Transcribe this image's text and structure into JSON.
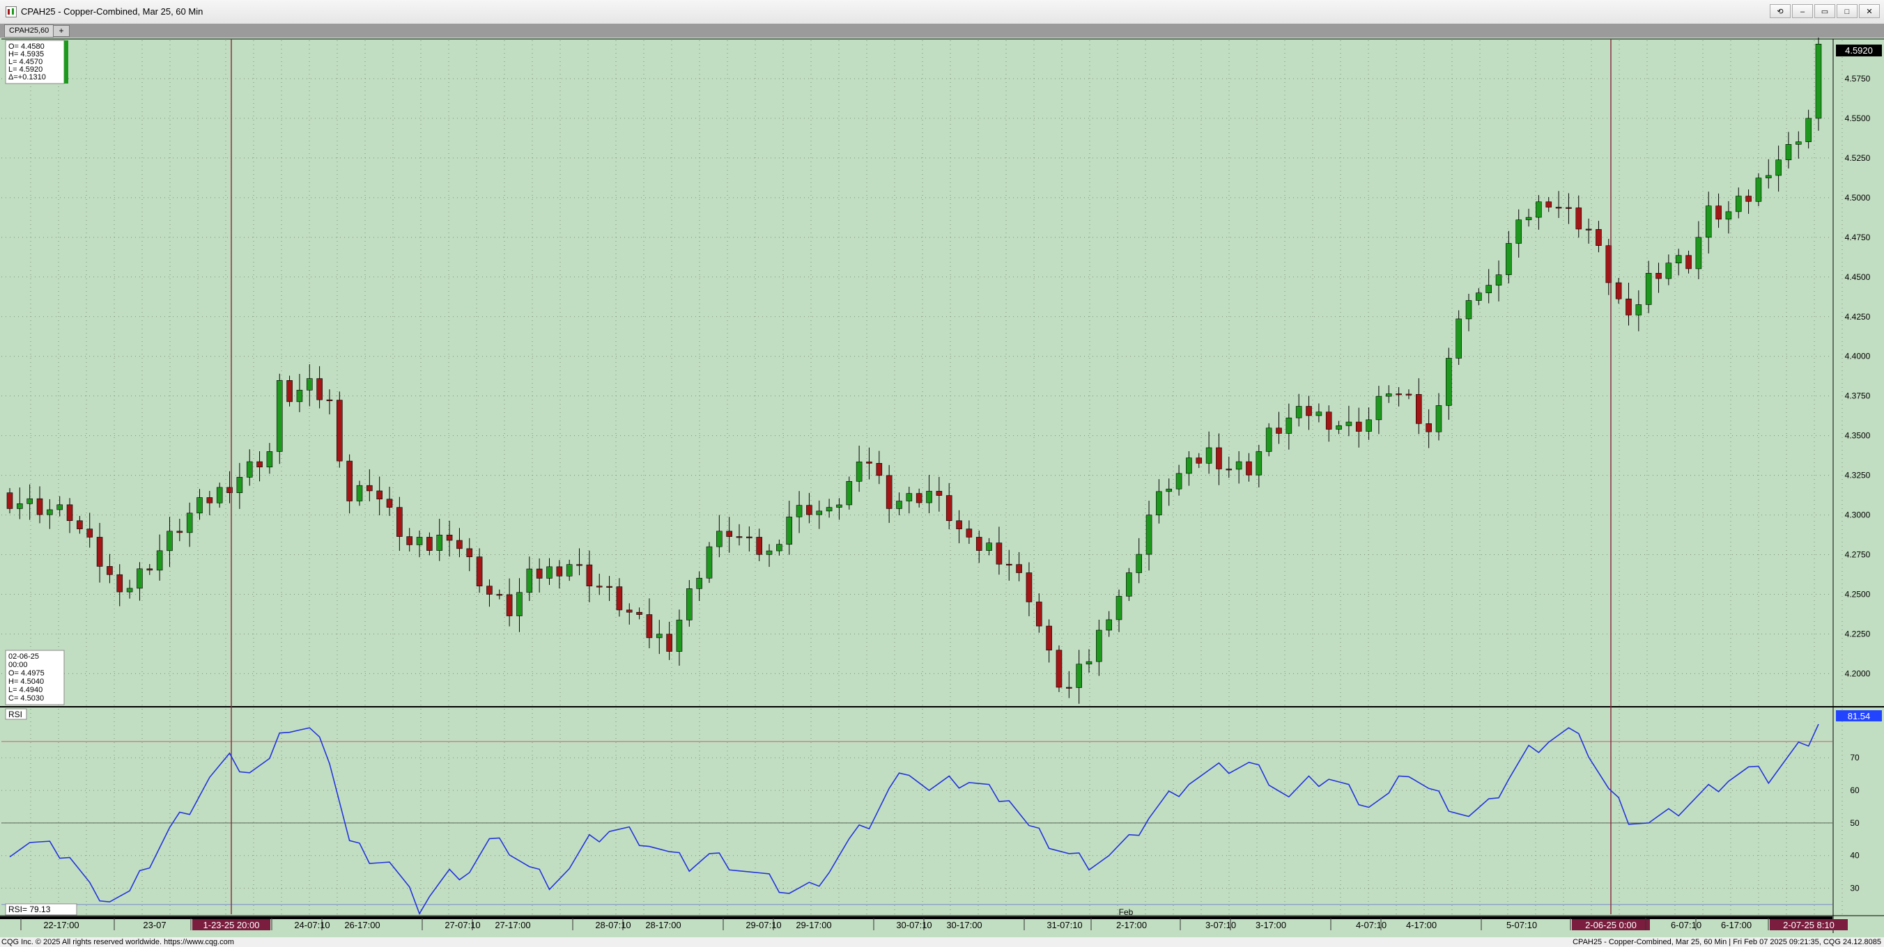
{
  "window": {
    "title": "CPAH25 - Copper-Combined, Mar 25, 60 Min",
    "controls": [
      "⟲",
      "–",
      "▭",
      "□",
      "✕"
    ]
  },
  "tabs": [
    {
      "label": "CPAH25,60"
    }
  ],
  "tab_add": "+",
  "price_panel": {
    "last_price": "4.5920",
    "price_ticks": [
      "4.5750",
      "4.5500",
      "4.5250",
      "4.5000",
      "4.4750",
      "4.4500",
      "4.4250",
      "4.4000",
      "4.3750",
      "4.3500",
      "4.3250",
      "4.3000",
      "4.2750",
      "4.2500",
      "4.2250",
      "4.2000"
    ],
    "top_info": [
      "O=  4.4580",
      "H=  4.5935",
      "L=  4.4570",
      "L=  4.5920",
      "Δ=+0.1310"
    ],
    "cursor_info": [
      "02-06-25",
      "00:00",
      "O=  4.4975",
      "H=  4.5040",
      "L=  4.4940",
      "C=  4.5030"
    ]
  },
  "rsi_panel": {
    "label": "RSI",
    "value_box": "81.54",
    "bottom_label": "RSI=   79.13",
    "ticks": [
      "70",
      "60",
      "50",
      "40",
      "30"
    ]
  },
  "time_axis": [
    {
      "label": "22-17:00"
    },
    {
      "label": "23-07"
    },
    {
      "label": "1-23-25  20:00",
      "highlight": true
    },
    {
      "label": "24-07:10"
    },
    {
      "label": "26-17:00"
    },
    {
      "label": "27-07:10"
    },
    {
      "label": "27-17:00"
    },
    {
      "label": "28-07:10"
    },
    {
      "label": "28-17:00"
    },
    {
      "label": "29-07:10"
    },
    {
      "label": "29-17:00"
    },
    {
      "label": "30-07:10"
    },
    {
      "label": "30-17:00"
    },
    {
      "label": "31-07:10"
    },
    {
      "label": "2-17:00"
    },
    {
      "label": "3-07:10"
    },
    {
      "label": "3-17:00"
    },
    {
      "label": "4-07:10"
    },
    {
      "label": "4-17:00"
    },
    {
      "label": "5-07:10"
    },
    {
      "label": "2-06-25   0:00",
      "highlight": true
    },
    {
      "label": "6-07:10"
    },
    {
      "label": "6-17:00"
    },
    {
      "label": "2-07-25   8:10",
      "highlight": true
    }
  ],
  "feb_label": "Feb",
  "footer": {
    "left": "CQG Inc. © 2025 All rights reserved worldwide. https://www.cqg.com",
    "right": "CPAH25 - Copper-Combined, Mar 25, 60 Min | Fri Feb 07 2025 09:21:35, CQG 24.12.8085"
  },
  "colors": {
    "background": "#c2dec2",
    "up": "#1d9a1d",
    "down": "#a51515",
    "rsi": "#2233dd",
    "highlight": "#7a1d3e"
  },
  "chart_data": [
    {
      "type": "candlestick",
      "title": "CPAH25 - Copper-Combined, Mar 25, 60 Min",
      "ylim": [
        4.18,
        4.6
      ],
      "close_path": [
        [
          0,
          4.31
        ],
        [
          6,
          4.3
        ],
        [
          10,
          4.26
        ],
        [
          12,
          4.255
        ],
        [
          14,
          4.27
        ],
        [
          18,
          4.3
        ],
        [
          22,
          4.32
        ],
        [
          24,
          4.33
        ],
        [
          26,
          4.34
        ],
        [
          27,
          4.38
        ],
        [
          28,
          4.375
        ],
        [
          30,
          4.38
        ],
        [
          32,
          4.37
        ],
        [
          34,
          4.31
        ],
        [
          36,
          4.32
        ],
        [
          38,
          4.3
        ],
        [
          40,
          4.28
        ],
        [
          42,
          4.28
        ],
        [
          44,
          4.29
        ],
        [
          46,
          4.27
        ],
        [
          48,
          4.25
        ],
        [
          50,
          4.24
        ],
        [
          52,
          4.26
        ],
        [
          56,
          4.27
        ],
        [
          60,
          4.25
        ],
        [
          64,
          4.225
        ],
        [
          66,
          4.22
        ],
        [
          68,
          4.25
        ],
        [
          70,
          4.28
        ],
        [
          72,
          4.29
        ],
        [
          74,
          4.28
        ],
        [
          76,
          4.275
        ],
        [
          78,
          4.3
        ],
        [
          80,
          4.305
        ],
        [
          82,
          4.3
        ],
        [
          84,
          4.32
        ],
        [
          86,
          4.335
        ],
        [
          88,
          4.31
        ],
        [
          90,
          4.31
        ],
        [
          92,
          4.315
        ],
        [
          94,
          4.3
        ],
        [
          96,
          4.28
        ],
        [
          98,
          4.28
        ],
        [
          100,
          4.27
        ],
        [
          102,
          4.25
        ],
        [
          104,
          4.21
        ],
        [
          105,
          4.195
        ],
        [
          106,
          4.19
        ],
        [
          108,
          4.21
        ],
        [
          110,
          4.24
        ],
        [
          112,
          4.26
        ],
        [
          114,
          4.3
        ],
        [
          116,
          4.32
        ],
        [
          118,
          4.33
        ],
        [
          120,
          4.34
        ],
        [
          122,
          4.33
        ],
        [
          124,
          4.33
        ],
        [
          126,
          4.35
        ],
        [
          128,
          4.36
        ],
        [
          130,
          4.365
        ],
        [
          132,
          4.36
        ],
        [
          134,
          4.355
        ],
        [
          136,
          4.36
        ],
        [
          138,
          4.38
        ],
        [
          140,
          4.37
        ],
        [
          142,
          4.35
        ],
        [
          144,
          4.4
        ],
        [
          146,
          4.44
        ],
        [
          148,
          4.44
        ],
        [
          150,
          4.47
        ],
        [
          152,
          4.49
        ],
        [
          154,
          4.5
        ],
        [
          156,
          4.49
        ],
        [
          158,
          4.48
        ],
        [
          160,
          4.45
        ],
        [
          162,
          4.42
        ],
        [
          164,
          4.45
        ],
        [
          166,
          4.46
        ],
        [
          168,
          4.46
        ],
        [
          170,
          4.49
        ],
        [
          172,
          4.49
        ],
        [
          174,
          4.5
        ],
        [
          176,
          4.52
        ],
        [
          178,
          4.53
        ],
        [
          180,
          4.55
        ],
        [
          181,
          4.592
        ]
      ]
    },
    {
      "type": "line",
      "title": "RSI",
      "ylim": [
        22,
        85
      ],
      "ref_lines": [
        75,
        50,
        25
      ],
      "series": [
        {
          "name": "RSI",
          "values_path": [
            [
              0,
              42
            ],
            [
              2,
              44
            ],
            [
              4,
              42
            ],
            [
              6,
              40
            ],
            [
              8,
              30
            ],
            [
              10,
              27
            ],
            [
              12,
              28
            ],
            [
              14,
              38
            ],
            [
              16,
              48
            ],
            [
              18,
              55
            ],
            [
              20,
              64
            ],
            [
              22,
              69
            ],
            [
              24,
              66
            ],
            [
              26,
              68
            ],
            [
              27,
              80
            ],
            [
              28,
              79
            ],
            [
              30,
              78
            ],
            [
              32,
              70
            ],
            [
              34,
              44
            ],
            [
              36,
              40
            ],
            [
              38,
              38
            ],
            [
              40,
              28
            ],
            [
              41,
              24
            ],
            [
              42,
              28
            ],
            [
              44,
              34
            ],
            [
              46,
              36
            ],
            [
              48,
              44
            ],
            [
              50,
              42
            ],
            [
              52,
              36
            ],
            [
              54,
              32
            ],
            [
              56,
              36
            ],
            [
              58,
              44
            ],
            [
              60,
              48
            ],
            [
              62,
              47
            ],
            [
              64,
              44
            ],
            [
              66,
              40
            ],
            [
              68,
              37
            ],
            [
              70,
              40
            ],
            [
              72,
              38
            ],
            [
              74,
              35
            ],
            [
              76,
              32
            ],
            [
              78,
              29
            ],
            [
              80,
              30
            ],
            [
              82,
              36
            ],
            [
              84,
              44
            ],
            [
              86,
              50
            ],
            [
              88,
              60
            ],
            [
              90,
              67
            ],
            [
              92,
              60
            ],
            [
              94,
              62
            ],
            [
              96,
              63
            ],
            [
              98,
              60
            ],
            [
              100,
              58
            ],
            [
              102,
              48
            ],
            [
              104,
              44
            ],
            [
              106,
              40
            ],
            [
              108,
              38
            ],
            [
              110,
              40
            ],
            [
              112,
              44
            ],
            [
              114,
              52
            ],
            [
              116,
              58
            ],
            [
              118,
              63
            ],
            [
              120,
              65
            ],
            [
              122,
              67
            ],
            [
              124,
              68
            ],
            [
              126,
              64
            ],
            [
              128,
              58
            ],
            [
              130,
              62
            ],
            [
              132,
              64
            ],
            [
              134,
              60
            ],
            [
              136,
              56
            ],
            [
              138,
              58
            ],
            [
              140,
              66
            ],
            [
              142,
              60
            ],
            [
              144,
              56
            ],
            [
              146,
              52
            ],
            [
              148,
              55
            ],
            [
              150,
              64
            ],
            [
              152,
              72
            ],
            [
              154,
              76
            ],
            [
              156,
              78
            ],
            [
              158,
              72
            ],
            [
              160,
              60
            ],
            [
              162,
              52
            ],
            [
              164,
              50
            ],
            [
              166,
              52
            ],
            [
              168,
              56
            ],
            [
              170,
              60
            ],
            [
              172,
              64
            ],
            [
              174,
              66
            ],
            [
              176,
              64
            ],
            [
              178,
              70
            ],
            [
              180,
              76
            ],
            [
              181,
              81.5
            ]
          ]
        }
      ]
    }
  ]
}
